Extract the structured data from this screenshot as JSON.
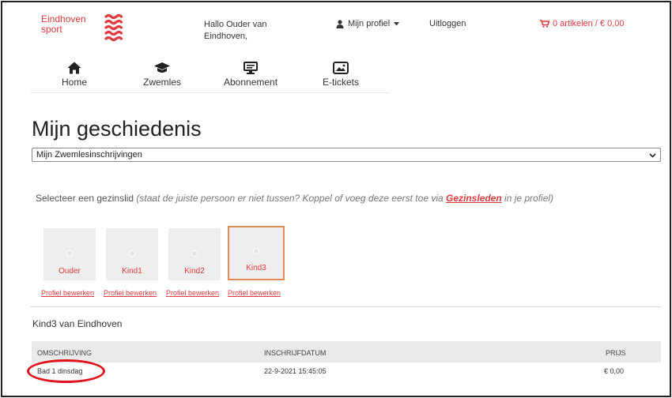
{
  "brand": {
    "line1": "Eindhoven",
    "line2": "sport",
    "color": "#e03a3e"
  },
  "header": {
    "greeting": "Hallo Ouder van Eindhoven,",
    "profile_label": "Mijn profiel",
    "profile_icon": "user-icon",
    "logout_label": "Uitloggen",
    "cart_label": "0 artikelen / € 0,00",
    "cart_icon": "cart-icon"
  },
  "nav": [
    {
      "label": "Home",
      "icon": "home-icon"
    },
    {
      "label": "Zwemles",
      "icon": "graduation-cap-icon"
    },
    {
      "label": "Abonnement",
      "icon": "monitor-icon"
    },
    {
      "label": "E-tickets",
      "icon": "ticket-image-icon"
    }
  ],
  "page_title": "Mijn geschiedenis",
  "history_select": {
    "selected": "Mijn Zwemlesinschrijvingen"
  },
  "hint": {
    "prefix": "Selecteer een gezinslid ",
    "italic": "(staat de juiste persoon er niet tussen? Koppel of voeg deze eerst toe via ",
    "link": "Gezinsleden",
    "suffix": " in je profiel)"
  },
  "members": [
    {
      "label": "Ouder",
      "selected": false
    },
    {
      "label": "Kind1",
      "selected": false
    },
    {
      "label": "Kind2",
      "selected": false
    },
    {
      "label": "Kind3",
      "selected": true
    }
  ],
  "edit_profile_label": "Profiel bewerken",
  "selected_person": "Kind3 van Eindhoven",
  "table": {
    "headers": {
      "description": "OMSCHRIJVING",
      "date": "INSCHRIJFDATUM",
      "price": "PRIJS"
    },
    "rows": [
      {
        "description": "Bad 1 dinsdag",
        "date": "22-9-2021 15:45:05",
        "price": "€ 0,00"
      }
    ]
  },
  "colors": {
    "accent": "#e03a3e",
    "selected_border": "#e08a55",
    "annotation": "#e0141e"
  }
}
